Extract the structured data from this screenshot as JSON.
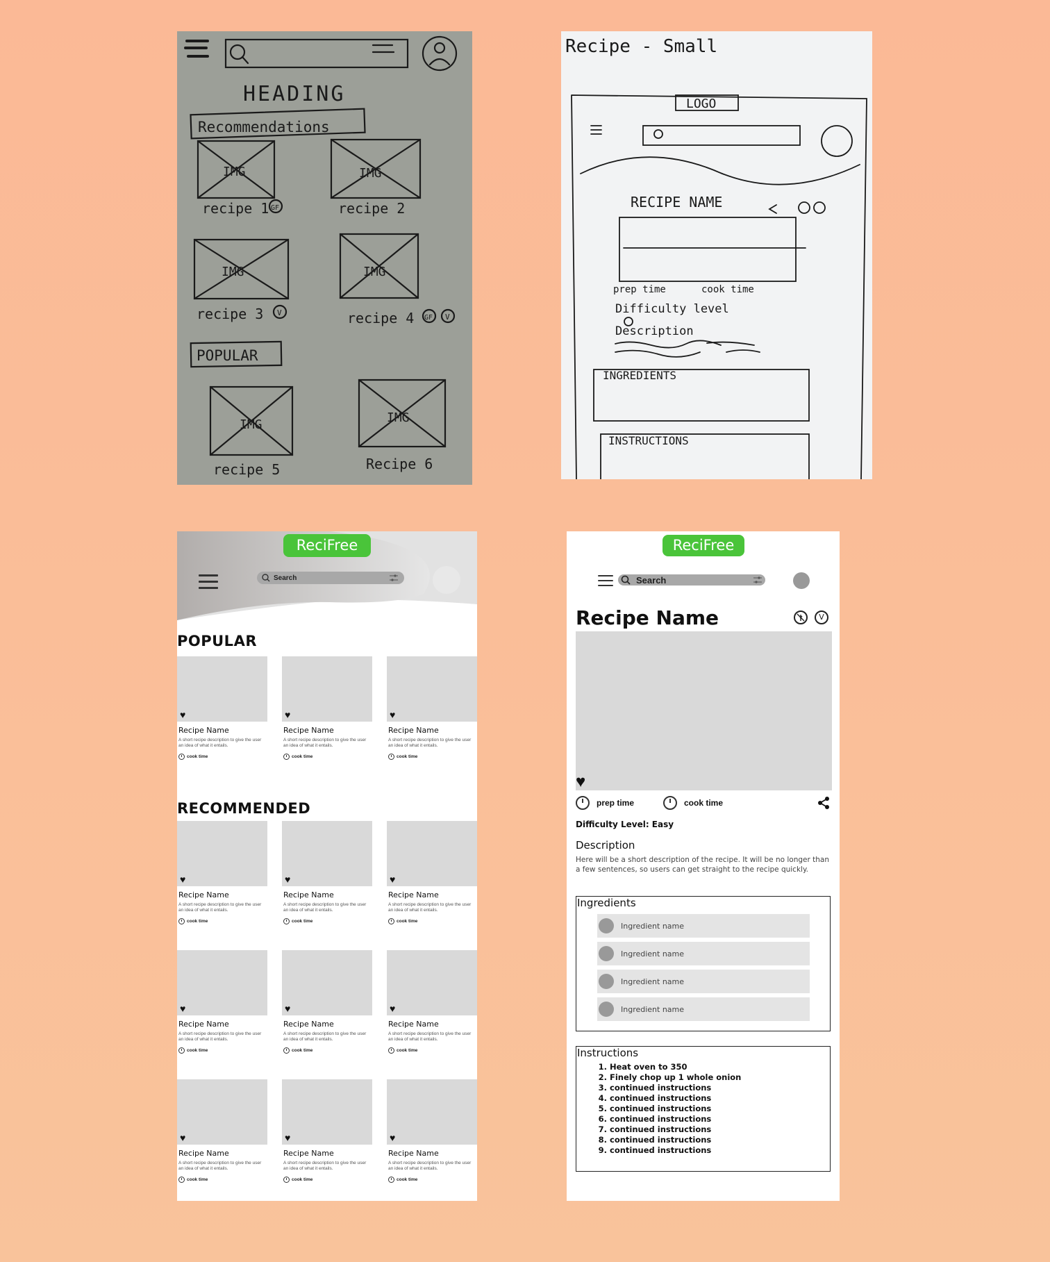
{
  "sketch_home": {
    "heading": "HEADING",
    "recommendations_label": "Recommendations",
    "popular_label": "POPULAR",
    "img_label": "IMG",
    "cards": [
      {
        "label": "recipe 1",
        "badges": [
          "GF"
        ]
      },
      {
        "label": "recipe 2",
        "badges": []
      },
      {
        "label": "recipe 3",
        "badges": [
          "V"
        ]
      },
      {
        "label": "recipe 4",
        "badges": [
          "GF",
          "V"
        ]
      },
      {
        "label": "recipe 5",
        "badges": []
      },
      {
        "label": "Recipe 6",
        "badges": []
      }
    ]
  },
  "sketch_detail": {
    "title": "Recipe - Small",
    "logo": "LOGO",
    "recipe_name": "RECIPE NAME",
    "prep_time": "prep time",
    "cook_time": "cook time",
    "difficulty": "Difficulty level",
    "description": "Description",
    "ingredients": "INGREDIENTS",
    "instructions": "INSTRUCTIONS"
  },
  "mock_list": {
    "brand": "ReciFree",
    "search_placeholder": "Search",
    "popular_heading": "POPULAR",
    "recommended_heading": "RECOMMENDED",
    "card": {
      "name": "Recipe Name",
      "desc": "A short recipe description to give the user an idea of what it entails.",
      "time": "cook time"
    }
  },
  "mock_detail": {
    "brand": "ReciFree",
    "search_placeholder": "Search",
    "recipe_name": "Recipe Name",
    "prep_time": "prep time",
    "cook_time": "cook time",
    "difficulty": "Difficulty Level: Easy",
    "description_heading": "Description",
    "description_text": "Here will be a short description of the recipe. It will be no longer than a few sentences, so users can get straight to the recipe quickly.",
    "ingredients_heading": "Ingredients",
    "ingredients": [
      "Ingredient name",
      "Ingredient name",
      "Ingredient name",
      "Ingredient name"
    ],
    "instructions_heading": "Instructions",
    "instructions": [
      "Heat oven to 350",
      "Finely chop up 1 whole onion",
      "continued instructions",
      "continued instructions",
      "continued instructions",
      "continued instructions",
      "continued instructions",
      "continued instructions",
      "continued instructions"
    ],
    "diet_icons": [
      "no-gluten-icon",
      "vegan-icon"
    ],
    "diet_vegan_letter": "V"
  },
  "colors": {
    "background": "#fbb996",
    "brand_green": "#4ac43a",
    "placeholder_grey": "#d9d9d9"
  }
}
